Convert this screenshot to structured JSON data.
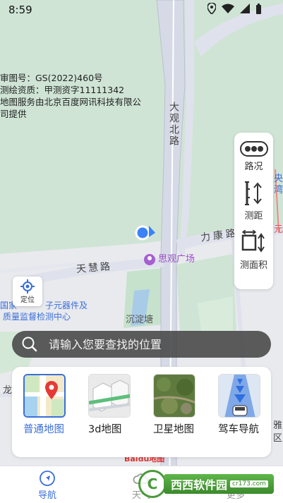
{
  "status_bar": {
    "time": "8:59"
  },
  "approval": {
    "line1": "审图号：GS(2022)460号",
    "line2": "测绘资质：甲测资字11111342",
    "line3": "地图服务由北京百度网讯科技有限公",
    "line4": "司提供"
  },
  "map_labels": {
    "road_dagu": "大观北路",
    "road_likang": "力康路",
    "road_tianhui": "天慧路",
    "poi_siguan": "思观广场",
    "poi_institute_line1": "国家",
    "poi_institute_line1b": "子元器件及",
    "poi_institute_line2": "质量监督检测中心",
    "poi_chendiantang": "沉淀塘",
    "edge_long": "龙",
    "edge_ya": "雅",
    "edge_qu": "区",
    "edge_yang": "央",
    "edge_wan": "湾",
    "edge_yuan": "元",
    "baidu_logo": "Baidu地图"
  },
  "tools": [
    {
      "label": "路况",
      "icon": "traffic-icon"
    },
    {
      "label": "测距",
      "icon": "ruler-icon"
    },
    {
      "label": "测面积",
      "icon": "area-icon"
    }
  ],
  "locate": {
    "label": "定位",
    "icon": "locate-icon"
  },
  "search": {
    "placeholder": "请输入您要查找的位置",
    "icon": "search-icon"
  },
  "map_types": [
    {
      "label": "普通地图",
      "active": true
    },
    {
      "label": "3d地图",
      "active": false
    },
    {
      "label": "卫星地图",
      "active": false
    },
    {
      "label": "驾车导航",
      "active": false
    }
  ],
  "tabs": [
    {
      "label": "导航",
      "active": true
    },
    {
      "label": "天气",
      "active": false
    },
    {
      "label": "更多",
      "active": false
    }
  ],
  "watermark": {
    "circle": "C",
    "text": "西西软件园",
    "sub": "cr173.com"
  },
  "colors": {
    "accent": "#3a6fd8",
    "map_green": "#cfe4d5",
    "road": "#d6dae6"
  }
}
